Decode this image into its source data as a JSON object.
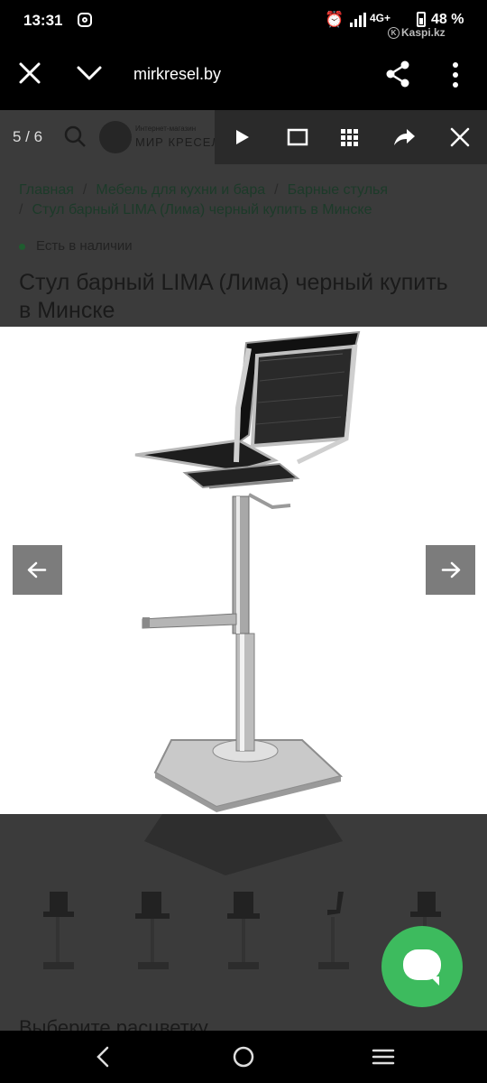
{
  "status_bar": {
    "time": "13:31",
    "network": "4G+",
    "battery": "48 %",
    "overlay_brand": "Kaspi.kz"
  },
  "browser": {
    "url": "mirkresel.by"
  },
  "gallery": {
    "counter": "5 / 6"
  },
  "site": {
    "logo_sub": "Интернет-магазин",
    "logo_text": "МИР КРЕСЕЛ",
    "breadcrumb": [
      "Главная",
      "Мебель для кухни и бара",
      "Барные стулья",
      "Стул барный LIMA (Лима) черный купить в Минске"
    ],
    "breadcrumb_separator": "/",
    "stock": "Есть в наличии",
    "title": "Стул барный LIMA (Лима) черный купить в Минске",
    "select_text": "Выберите расцветку"
  },
  "colors": {
    "overlay_dim": "#3b3b3b",
    "fab_green": "#3dbb5e",
    "arrow_gray": "#7c7c7c"
  }
}
